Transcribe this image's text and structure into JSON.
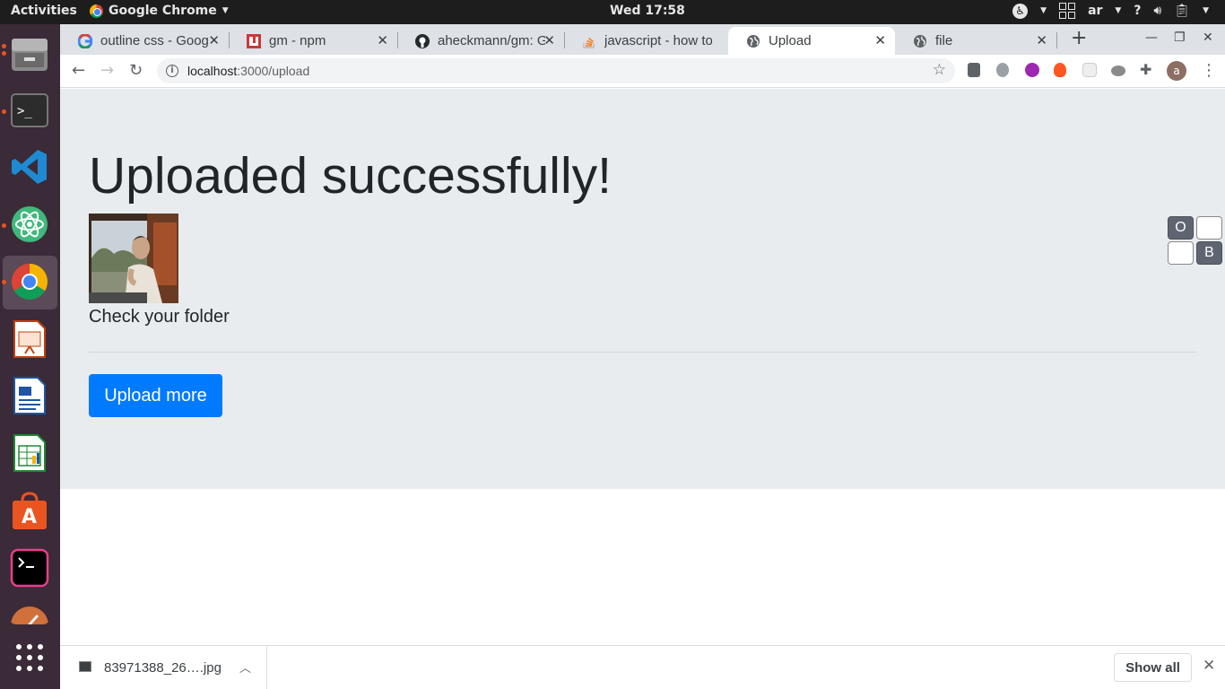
{
  "topbar": {
    "activities": "Activities",
    "app_name": "Google Chrome",
    "clock": "Wed 17:58",
    "keyboard_layout": "ar",
    "help": "?"
  },
  "dock": {
    "items": [
      "files-icon",
      "terminal-icon",
      "vscode-icon",
      "atom-icon",
      "chrome-icon",
      "impress-icon",
      "writer-icon",
      "calc-icon",
      "software-center-icon",
      "hyper-terminal-icon",
      "inkscape-icon",
      "show-apps-icon"
    ]
  },
  "tabs": [
    {
      "title": "outline css - Goog",
      "favicon": "google-icon"
    },
    {
      "title": "gm - npm",
      "favicon": "npm-icon"
    },
    {
      "title": "aheckmann/gm: G",
      "favicon": "github-icon"
    },
    {
      "title": "javascript - how to",
      "favicon": "stackoverflow-icon"
    },
    {
      "title": "Upload",
      "favicon": "globe-icon",
      "active": true
    },
    {
      "title": "file",
      "favicon": "globe-icon"
    }
  ],
  "omnibox": {
    "host": "localhost",
    "path": ":3000/upload"
  },
  "page": {
    "heading": "Uploaded successfully!",
    "subtext": "Check your folder",
    "button": "Upload more",
    "widget": {
      "o": "O",
      "b": "B"
    }
  },
  "download_bar": {
    "filename": "83971388_26….jpg",
    "show_all": "Show all"
  },
  "colors": {
    "primary_button": "#007bff",
    "jumbotron": "#e9ecef",
    "dock": "#3b2a37",
    "topbar": "#1d1d1d"
  }
}
